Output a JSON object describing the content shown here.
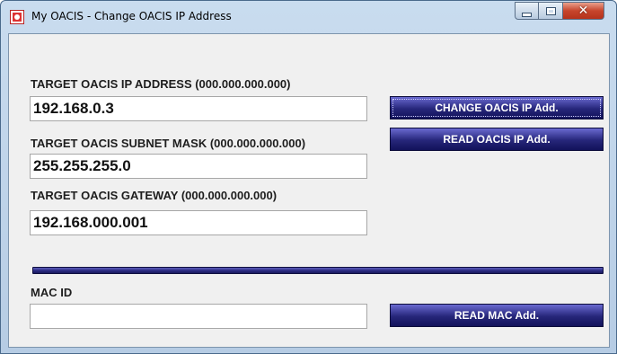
{
  "window": {
    "title": "My OACIS - Change OACIS IP Address",
    "icon": "app-icon",
    "controls": [
      "minimize-icon",
      "maximize-icon",
      "close-icon"
    ],
    "close_glyph": "✕"
  },
  "form": {
    "ip_label": "TARGET OACIS IP ADDRESS (000.000.000.000)",
    "ip_value": "192.168.0.3",
    "subnet_label": "TARGET OACIS SUBNET MASK (000.000.000.000)",
    "subnet_value": "255.255.255.0",
    "gateway_label": "TARGET OACIS GATEWAY (000.000.000.000)",
    "gateway_value": "192.168.000.001",
    "mac_label": "MAC ID",
    "mac_value": ""
  },
  "buttons": {
    "change_ip": "CHANGE OACIS IP Add.",
    "read_ip": "READ OACIS IP Add.",
    "read_mac": "READ MAC Add."
  },
  "colors": {
    "button_top": "#6a6ad0",
    "button_bottom": "#12125a",
    "close_button": "#c7452c",
    "window_frame": "#b6cce4"
  }
}
